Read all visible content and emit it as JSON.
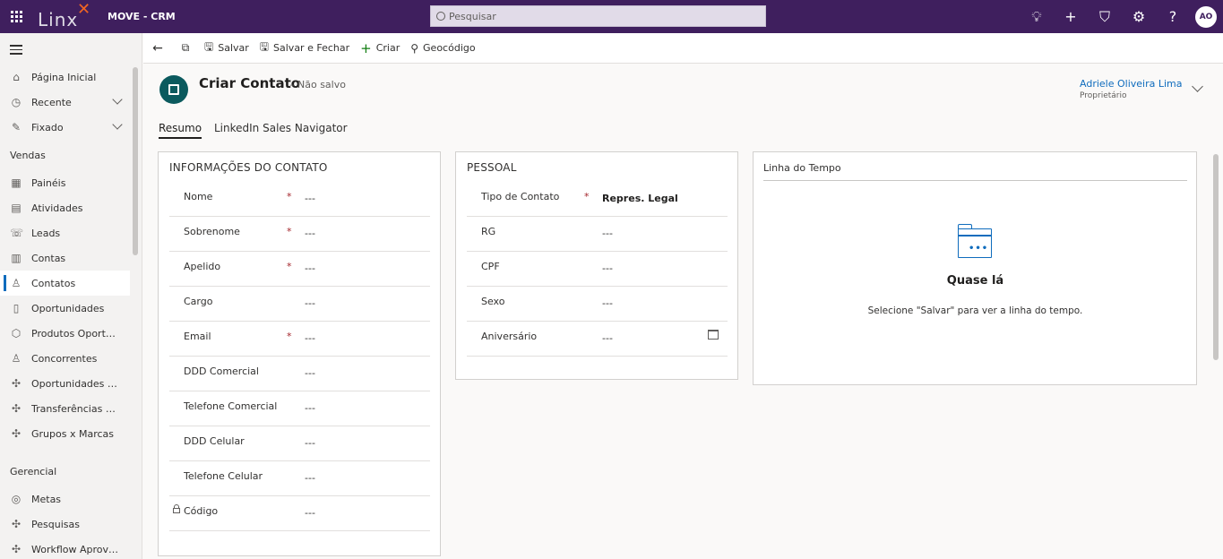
{
  "app": {
    "logo_text": "Linx",
    "title": "MOVE - CRM"
  },
  "search": {
    "placeholder": "Pesquisar"
  },
  "topbar": {
    "icons": [
      "lightbulb-icon",
      "plus-icon",
      "filter-icon",
      "gear-icon",
      "help-icon"
    ],
    "user_initials": "AO"
  },
  "sidebar": {
    "top_items": [
      {
        "label": "Página Inicial",
        "icon": "home-icon"
      },
      {
        "label": "Recente",
        "icon": "clock-icon"
      },
      {
        "label": "Fixado",
        "icon": "pin-icon"
      }
    ],
    "group_vendas": "Vendas",
    "vendas_items": [
      {
        "label": "Painéis",
        "icon": "dashboard-icon"
      },
      {
        "label": "Atividades",
        "icon": "clipboard-icon"
      },
      {
        "label": "Leads",
        "icon": "phone-icon"
      },
      {
        "label": "Contas",
        "icon": "building-icon"
      },
      {
        "label": "Contatos",
        "icon": "person-icon"
      },
      {
        "label": "Oportunidades",
        "icon": "opportunity-icon"
      },
      {
        "label": "Produtos Oportun...",
        "icon": "box-icon"
      },
      {
        "label": "Concorrentes",
        "icon": "competitor-icon"
      },
      {
        "label": "Oportunidades e...",
        "icon": "puzzle-icon"
      },
      {
        "label": "Transferências de ...",
        "icon": "puzzle-icon"
      },
      {
        "label": "Grupos x Marcas",
        "icon": "puzzle-icon"
      }
    ],
    "group_gerencial": "Gerencial",
    "gerencial_items": [
      {
        "label": "Metas",
        "icon": "target-icon"
      },
      {
        "label": "Pesquisas",
        "icon": "puzzle-icon"
      },
      {
        "label": "Workflow Aprova...",
        "icon": "puzzle-icon"
      }
    ]
  },
  "commandbar": {
    "save": "Salvar",
    "save_close": "Salvar e Fechar",
    "create": "Criar",
    "geocode": "Geocódigo"
  },
  "record": {
    "title": "Criar Contato",
    "status": "– Não salvo",
    "owner_name": "Adriele Oliveira Lima",
    "owner_role": "Proprietário"
  },
  "tabs": [
    "Resumo",
    "LinkedIn Sales Navigator"
  ],
  "contact_info": {
    "title": "INFORMAÇÕES DO CONTATO",
    "fields": [
      {
        "label": "Nome",
        "required": "*",
        "value": "---"
      },
      {
        "label": "Sobrenome",
        "required": "*",
        "value": "---"
      },
      {
        "label": "Apelido",
        "required": "*",
        "value": "---"
      },
      {
        "label": "Cargo",
        "required": "",
        "value": "---"
      },
      {
        "label": "Email",
        "required": "*",
        "value": "---"
      },
      {
        "label": "DDD Comercial",
        "required": "",
        "value": "---"
      },
      {
        "label": "Telefone Comercial",
        "required": "",
        "value": "---"
      },
      {
        "label": "DDD Celular",
        "required": "",
        "value": "---"
      },
      {
        "label": "Telefone Celular",
        "required": "",
        "value": "---"
      },
      {
        "label": "Código",
        "required": "",
        "value": "---"
      }
    ]
  },
  "personal": {
    "title": "PESSOAL",
    "fields": [
      {
        "label": "Tipo de Contato",
        "required": "*",
        "value": "Repres. Legal"
      },
      {
        "label": "RG",
        "required": "",
        "value": "---"
      },
      {
        "label": "CPF",
        "required": "",
        "value": "---"
      },
      {
        "label": "Sexo",
        "required": "",
        "value": "---"
      },
      {
        "label": "Aniversário",
        "required": "",
        "value": "---"
      }
    ]
  },
  "timeline": {
    "title": "Linha do Tempo",
    "dots": "•••",
    "heading": "Quase lá",
    "message": "Selecione \"Salvar\" para ver a linha do tempo."
  }
}
